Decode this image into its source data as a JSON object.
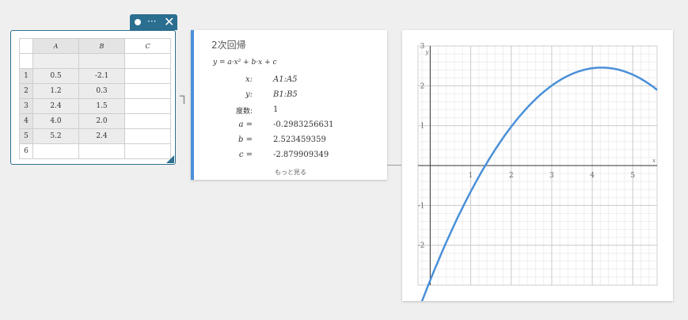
{
  "spreadsheet": {
    "toolbar": {
      "more_icon": "···",
      "close_icon": "✕"
    },
    "columns": [
      "A",
      "B",
      "C"
    ],
    "rows": [
      {
        "num": "1",
        "a": "0.5",
        "b": "-2.1",
        "c": ""
      },
      {
        "num": "2",
        "a": "1.2",
        "b": "0.3",
        "c": ""
      },
      {
        "num": "3",
        "a": "2.4",
        "b": "1.5",
        "c": ""
      },
      {
        "num": "4",
        "a": "4.0",
        "b": "2.0",
        "c": ""
      },
      {
        "num": "5",
        "a": "5.2",
        "b": "2.4",
        "c": ""
      },
      {
        "num": "6",
        "a": "",
        "b": "",
        "c": ""
      }
    ]
  },
  "regression": {
    "title": "2次回帰",
    "formula": "y = a·x² + b·x + c",
    "x_label": "x:",
    "x_value": "A1:A5",
    "y_label": "y:",
    "y_value": "B1:B5",
    "degree_label": "度数:",
    "degree_value": "1",
    "a_label": "a =",
    "a_value": "-0.2983256631",
    "b_label": "b =",
    "b_value": "2.523459359",
    "c_label": "c =",
    "c_value": "-2.879909349",
    "more_label": "もっと見る"
  },
  "graph": {
    "x_axis_label": "x",
    "y_axis_label": "y",
    "x_ticks": [
      "1",
      "2",
      "3",
      "4",
      "5"
    ],
    "y_ticks": [
      "3",
      "2",
      "1",
      "-1",
      "-2"
    ],
    "curve_color": "#4a90d9",
    "xlim": [
      -0.3,
      5.6
    ],
    "ylim": [
      -3,
      3
    ]
  }
}
